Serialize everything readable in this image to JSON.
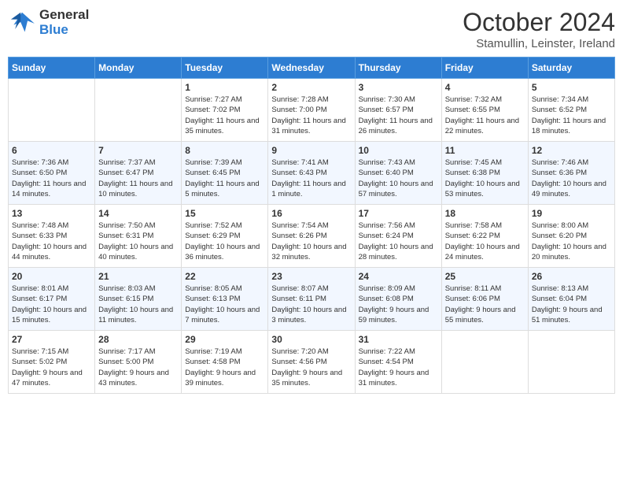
{
  "header": {
    "logo_line1": "General",
    "logo_line2": "Blue",
    "title": "October 2024",
    "subtitle": "Stamullin, Leinster, Ireland"
  },
  "days_of_week": [
    "Sunday",
    "Monday",
    "Tuesday",
    "Wednesday",
    "Thursday",
    "Friday",
    "Saturday"
  ],
  "weeks": [
    [
      {
        "day": "",
        "info": ""
      },
      {
        "day": "",
        "info": ""
      },
      {
        "day": "1",
        "info": "Sunrise: 7:27 AM\nSunset: 7:02 PM\nDaylight: 11 hours and 35 minutes."
      },
      {
        "day": "2",
        "info": "Sunrise: 7:28 AM\nSunset: 7:00 PM\nDaylight: 11 hours and 31 minutes."
      },
      {
        "day": "3",
        "info": "Sunrise: 7:30 AM\nSunset: 6:57 PM\nDaylight: 11 hours and 26 minutes."
      },
      {
        "day": "4",
        "info": "Sunrise: 7:32 AM\nSunset: 6:55 PM\nDaylight: 11 hours and 22 minutes."
      },
      {
        "day": "5",
        "info": "Sunrise: 7:34 AM\nSunset: 6:52 PM\nDaylight: 11 hours and 18 minutes."
      }
    ],
    [
      {
        "day": "6",
        "info": "Sunrise: 7:36 AM\nSunset: 6:50 PM\nDaylight: 11 hours and 14 minutes."
      },
      {
        "day": "7",
        "info": "Sunrise: 7:37 AM\nSunset: 6:47 PM\nDaylight: 11 hours and 10 minutes."
      },
      {
        "day": "8",
        "info": "Sunrise: 7:39 AM\nSunset: 6:45 PM\nDaylight: 11 hours and 5 minutes."
      },
      {
        "day": "9",
        "info": "Sunrise: 7:41 AM\nSunset: 6:43 PM\nDaylight: 11 hours and 1 minute."
      },
      {
        "day": "10",
        "info": "Sunrise: 7:43 AM\nSunset: 6:40 PM\nDaylight: 10 hours and 57 minutes."
      },
      {
        "day": "11",
        "info": "Sunrise: 7:45 AM\nSunset: 6:38 PM\nDaylight: 10 hours and 53 minutes."
      },
      {
        "day": "12",
        "info": "Sunrise: 7:46 AM\nSunset: 6:36 PM\nDaylight: 10 hours and 49 minutes."
      }
    ],
    [
      {
        "day": "13",
        "info": "Sunrise: 7:48 AM\nSunset: 6:33 PM\nDaylight: 10 hours and 44 minutes."
      },
      {
        "day": "14",
        "info": "Sunrise: 7:50 AM\nSunset: 6:31 PM\nDaylight: 10 hours and 40 minutes."
      },
      {
        "day": "15",
        "info": "Sunrise: 7:52 AM\nSunset: 6:29 PM\nDaylight: 10 hours and 36 minutes."
      },
      {
        "day": "16",
        "info": "Sunrise: 7:54 AM\nSunset: 6:26 PM\nDaylight: 10 hours and 32 minutes."
      },
      {
        "day": "17",
        "info": "Sunrise: 7:56 AM\nSunset: 6:24 PM\nDaylight: 10 hours and 28 minutes."
      },
      {
        "day": "18",
        "info": "Sunrise: 7:58 AM\nSunset: 6:22 PM\nDaylight: 10 hours and 24 minutes."
      },
      {
        "day": "19",
        "info": "Sunrise: 8:00 AM\nSunset: 6:20 PM\nDaylight: 10 hours and 20 minutes."
      }
    ],
    [
      {
        "day": "20",
        "info": "Sunrise: 8:01 AM\nSunset: 6:17 PM\nDaylight: 10 hours and 15 minutes."
      },
      {
        "day": "21",
        "info": "Sunrise: 8:03 AM\nSunset: 6:15 PM\nDaylight: 10 hours and 11 minutes."
      },
      {
        "day": "22",
        "info": "Sunrise: 8:05 AM\nSunset: 6:13 PM\nDaylight: 10 hours and 7 minutes."
      },
      {
        "day": "23",
        "info": "Sunrise: 8:07 AM\nSunset: 6:11 PM\nDaylight: 10 hours and 3 minutes."
      },
      {
        "day": "24",
        "info": "Sunrise: 8:09 AM\nSunset: 6:08 PM\nDaylight: 9 hours and 59 minutes."
      },
      {
        "day": "25",
        "info": "Sunrise: 8:11 AM\nSunset: 6:06 PM\nDaylight: 9 hours and 55 minutes."
      },
      {
        "day": "26",
        "info": "Sunrise: 8:13 AM\nSunset: 6:04 PM\nDaylight: 9 hours and 51 minutes."
      }
    ],
    [
      {
        "day": "27",
        "info": "Sunrise: 7:15 AM\nSunset: 5:02 PM\nDaylight: 9 hours and 47 minutes."
      },
      {
        "day": "28",
        "info": "Sunrise: 7:17 AM\nSunset: 5:00 PM\nDaylight: 9 hours and 43 minutes."
      },
      {
        "day": "29",
        "info": "Sunrise: 7:19 AM\nSunset: 4:58 PM\nDaylight: 9 hours and 39 minutes."
      },
      {
        "day": "30",
        "info": "Sunrise: 7:20 AM\nSunset: 4:56 PM\nDaylight: 9 hours and 35 minutes."
      },
      {
        "day": "31",
        "info": "Sunrise: 7:22 AM\nSunset: 4:54 PM\nDaylight: 9 hours and 31 minutes."
      },
      {
        "day": "",
        "info": ""
      },
      {
        "day": "",
        "info": ""
      }
    ]
  ]
}
